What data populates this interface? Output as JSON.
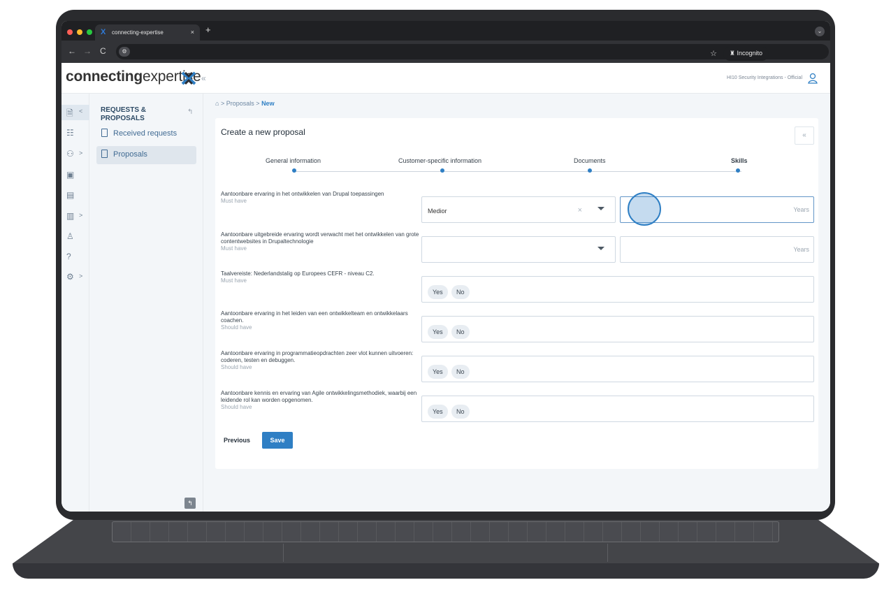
{
  "browser": {
    "tab_title": "connecting-expertise",
    "tab_close": "×",
    "new_tab": "+",
    "menu_icon": "chevron-down-icon",
    "back": "←",
    "forward": "→",
    "reload": "C",
    "site_info": "⚙",
    "bookmark_icon": "☆",
    "incognito_label": "Incognito"
  },
  "header": {
    "logo_part1": "connecting",
    "logo_part2": "expertise",
    "collapse_label": "«",
    "tenant": "HI10 Security Integrations - Official"
  },
  "rail": {
    "items": [
      {
        "icon": "proposal-icon",
        "glyph": "🗎",
        "chevron": "<"
      },
      {
        "icon": "handshake-icon",
        "glyph": "☷",
        "chevron": ""
      },
      {
        "icon": "team-icon",
        "glyph": "⚇",
        "chevron": ">"
      },
      {
        "icon": "folder-icon",
        "glyph": "▣",
        "chevron": ""
      },
      {
        "icon": "document-icon",
        "glyph": "▤",
        "chevron": ""
      },
      {
        "icon": "report-icon",
        "glyph": "▥",
        "chevron": ">"
      },
      {
        "icon": "people-icon",
        "glyph": "♙",
        "chevron": ""
      },
      {
        "icon": "help-icon",
        "glyph": "?",
        "chevron": ""
      },
      {
        "icon": "settings-icon",
        "glyph": "⚙",
        "chevron": ">"
      }
    ]
  },
  "submenu": {
    "title": "REQUESTS & PROPOSALS",
    "back_icon": "↰",
    "items": [
      {
        "label": "Received requests"
      },
      {
        "label": "Proposals"
      }
    ],
    "bottom_icon": "↰"
  },
  "breadcrumb": {
    "home_icon": "⌂",
    "separator1": ">",
    "proposals": "Proposals",
    "separator2": ">",
    "current": "New"
  },
  "form": {
    "title": "Create a new proposal",
    "collapse": "«",
    "steps": [
      {
        "label": "General information"
      },
      {
        "label": "Customer-specific information"
      },
      {
        "label": "Documents"
      },
      {
        "label": "Skills"
      }
    ],
    "questions": [
      {
        "text": "Aantoonbare ervaring in het ontwikkelen van Drupal toepassingen",
        "requirement": "Must have",
        "select_value": "Medior",
        "clear_icon": "×",
        "years_placeholder": "Years"
      },
      {
        "text": "Aantoonbare uitgebreide ervaring wordt verwacht met het ontwikkelen van grote contentwebsites in Drupaltechnologie",
        "requirement": "Must have",
        "select_value": "",
        "years_placeholder": "Years"
      },
      {
        "text": "Taalvereiste: Nederlandstalig op Europees CEFR - niveau C2.",
        "requirement": "Must have",
        "yes": "Yes",
        "no": "No"
      },
      {
        "text": "Aantoonbare ervaring in het leiden van een ontwikkelteam en ontwikkelaars coachen.",
        "requirement": "Should have",
        "yes": "Yes",
        "no": "No"
      },
      {
        "text": "Aantoonbare ervaring in programmatieopdrachten zeer vlot kunnen uitvoeren: coderen, testen en debuggen.",
        "requirement": "Should have",
        "yes": "Yes",
        "no": "No"
      },
      {
        "text": "Aantoonbare kennis en ervaring van Agile ontwikkelingsmethodiek, waarbij een leidende rol kan worden opgenomen.",
        "requirement": "Should have",
        "yes": "Yes",
        "no": "No"
      }
    ],
    "previous": "Previous",
    "save": "Save"
  },
  "colors": {
    "accent": "#2f7fc4",
    "sidebar_bg": "#f3f6f9",
    "frame": "#2a2b2e"
  }
}
